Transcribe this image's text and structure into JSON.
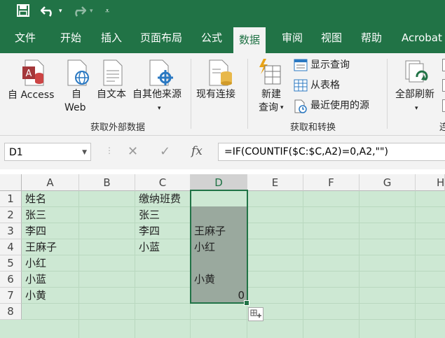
{
  "quick_access": {
    "save_icon": "save-icon",
    "undo_icon": "undo-icon",
    "redo_icon": "redo-icon",
    "customize_icon": "customize-qat-icon"
  },
  "tabs": [
    "文件",
    "开始",
    "插入",
    "页面布局",
    "公式",
    "数据",
    "审阅",
    "视图",
    "帮助",
    "Acrobat"
  ],
  "active_tab": "数据",
  "ribbon": {
    "from_access": "自 Access",
    "from_web_1": "自",
    "from_web_2": "Web",
    "from_text": "自文本",
    "from_other": "自其他来源",
    "existing_connections": "现有连接",
    "group_external": "获取外部数据",
    "new_query_1": "新建",
    "new_query_2": "查询",
    "show_queries": "显示查询",
    "from_table": "从表格",
    "recent_sources": "最近使用的源",
    "group_get_transform": "获取和转换",
    "refresh_all": "全部刷新",
    "group_conn_partial": "连"
  },
  "name_box": "D1",
  "formula": "=IF(COUNTIF($C:$C,A2)=0,A2,\"\")",
  "fx_label": "fx",
  "columns": [
    "A",
    "B",
    "C",
    "D",
    "E",
    "F",
    "G",
    "H"
  ],
  "rows": [
    "1",
    "2",
    "3",
    "4",
    "5",
    "6",
    "7",
    "8"
  ],
  "cells": {
    "A1": "姓名",
    "A2": "张三",
    "A3": "李四",
    "A4": "王麻子",
    "A5": "小红",
    "A6": "小蓝",
    "A7": "小黄",
    "C1": "缴纳班费",
    "C2": "张三",
    "C3": "李四",
    "C4": "小蓝",
    "D3": "王麻子",
    "D4": "小红",
    "D6": "小黄",
    "D7": "0"
  },
  "colors": {
    "accent": "#217346",
    "selection": "#cde8d3"
  }
}
